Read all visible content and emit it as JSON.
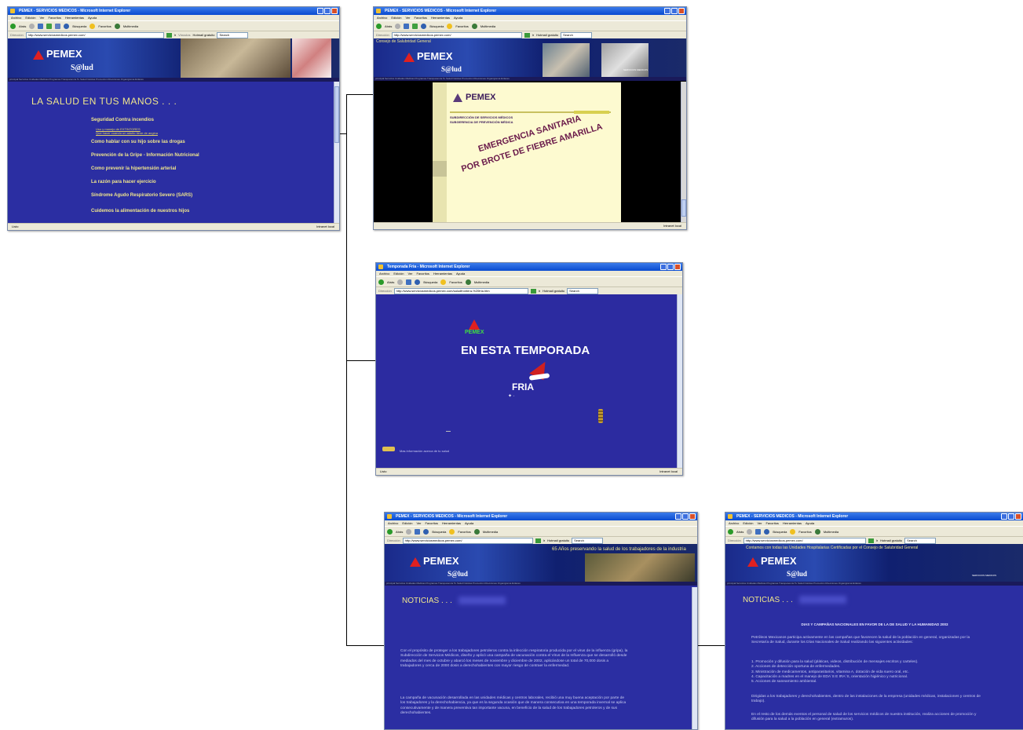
{
  "browser": {
    "menu": [
      "Archivo",
      "Edición",
      "Ver",
      "Favoritos",
      "Herramientas",
      "Ayuda"
    ],
    "toolbar": {
      "back": "Atrás",
      "search": "Búsqueda",
      "favorites": "Favoritos",
      "multimedia": "Multimedia"
    },
    "address_label": "Dirección",
    "address_url": "http://www.serviciosmedicos.pemex.com/",
    "address_url_cold": "http://www.serviciosmedicos.pemex.com/saludfrontera-%20fria.htm",
    "go": "Ir",
    "links_label": "Vínculos",
    "hotmail": "Hotmail gratuito",
    "search_label": "Search",
    "status_done": "Listo",
    "status_zone": "Intranet local"
  },
  "window1": {
    "title": "PEMEX - SERVICIOS MEDICOS - Microsoft Internet Explorer",
    "brand": "PEMEX",
    "salud": "S@lud",
    "navstrip": "principal  Servicios  Unidades Médicas  Programas  Transparencia  Tu Salud  Noticias  Promoción  Direcciones  Organigrama  Enlaces",
    "heading": "LA SALUD EN TUS MANOS . . .",
    "items": [
      {
        "label": "Seguridad Contra incendios",
        "subs": [
          "Uso y manejo de EXTINTORES",
          "Que hacer cuando un adulto tiene de angina"
        ]
      },
      {
        "label": "Como hablar con su hijo sobre las drogas"
      },
      {
        "label": "Prevención de la Gripe - Información Nutricional"
      },
      {
        "label": "Como prevenir la hipertensión arterial"
      },
      {
        "label": "La razón para hacer ejercicio"
      },
      {
        "label": "Síndrome Agudo Respiratorio Severo (SARS)"
      },
      {
        "label": "Cuidemos la alimentación de nuestros hijos"
      }
    ]
  },
  "window2": {
    "title": "PEMEX - SERVICIOS MEDICOS - Microsoft Internet Explorer",
    "banner_text": "Consejo de Salubridad General",
    "brand": "PEMEX",
    "salud": "S@lud",
    "photo_caption": "SERVICIOS MEDICOS",
    "doc_brand": "PEMEX",
    "doc_line1": "SUBDIRECCIÓN DE SERVICIOS MÉDICOS",
    "doc_line2": "SUBGERENCIA DE PREVENCIÓN MÉDICA",
    "emergency_line1": "EMERGENCIA SANITARIA",
    "emergency_line2": "POR BROTE DE FIEBRE AMARILLA"
  },
  "window3": {
    "title": "Temporada Fria - Microsoft Internet Explorer",
    "brand": "PEMEX",
    "headline": "EN ESTA TEMPORADA",
    "fria": "FRIA",
    "more_info": "Mas información acerca de tu salud"
  },
  "window4": {
    "title": "PEMEX - SERVICIOS MEDICOS - Microsoft Internet Explorer",
    "marquee": "65 Años preservando la salud de los trabajadores de la industria",
    "brand": "PEMEX",
    "salud": "S@lud",
    "heading": "NOTICIAS . . .",
    "para1": "Con el propósito de proteger a los trabajadores petroleros contra la infección respiratoria producida por el virus de la influenza (gripa), la Subdirección de Servicios Médicos, diseño y aplicó una campaña de vacunación contra el Virus de la Influenza que se desarrolló desde mediados del mes de octubre y abarcó los meses de noviembre y diciembre de 2002, aplicándose un total de 70,000 dosis a trabajadores y cerca de 2000 dosis a derechohabientes con mayor riesgo de contraer la enfermedad.",
    "para2": "La campaña de vacunación desarrollada en las unidades médicas y centros laborales, recibió una muy buena aceptación por parte de los trabajadores y la derechohabiencia, ya que es la segunda ocasión que de manera consecutiva en una temporada invernal se aplica consecutivamente y de manera preventiva tan importante vacuna, en beneficio de la salud de los trabajadores petroleros y de sus derechohabientes."
  },
  "window5": {
    "title": "PEMEX - SERVICIOS MEDICOS - Microsoft Internet Explorer",
    "marquee": "Contamos con todas las Unidades Hospitalarias Certificadas por el Consejo de Salubridad General",
    "brand": "PEMEX",
    "salud": "S@lud",
    "photo_caption": "SERVICIOS MEDICOS",
    "heading": "NOTICIAS . . .",
    "title_center": "DIAS Y CAMPAÑAS NACIONALES EN FAVOR DE LA DE SALUD Y LA HUMANIDAD 2003",
    "intro": "Petróleos Mexicanos participa activamente en las campañas que favorecen la salud de la población en general, organizadas por la Secretaría de Salud, durante los Días Nacionales de Salud realizando las siguientes actividades:",
    "list": [
      "1. Promoción y difusión para la salud (pláticas, videos, distribución de mensajes escritos y carteles).",
      "2. Acciones de detección oportuna de enfermedades.",
      "3. Ministración de medicamentos, antiparasitarios, vitamina A, dotación de vida suero oral, etc.",
      "4. Capacitación a madres en el manejo de EDA´S E IRA´S, orientación higiénico y nutricional.",
      "5. Acciones de saneamiento ambiental."
    ],
    "para2": "Dirigidas a los trabajadores y derechohabientes, dentro de las instalaciones de la empresa (unidades médicas, instalaciones y centros de trabajo).",
    "para3": "En el resto de los demás eventos el personal de salud de los servicios médicos de nuestra institución, realiza acciones de promoción y difusión para la salud a la población en general (extramuros)."
  }
}
